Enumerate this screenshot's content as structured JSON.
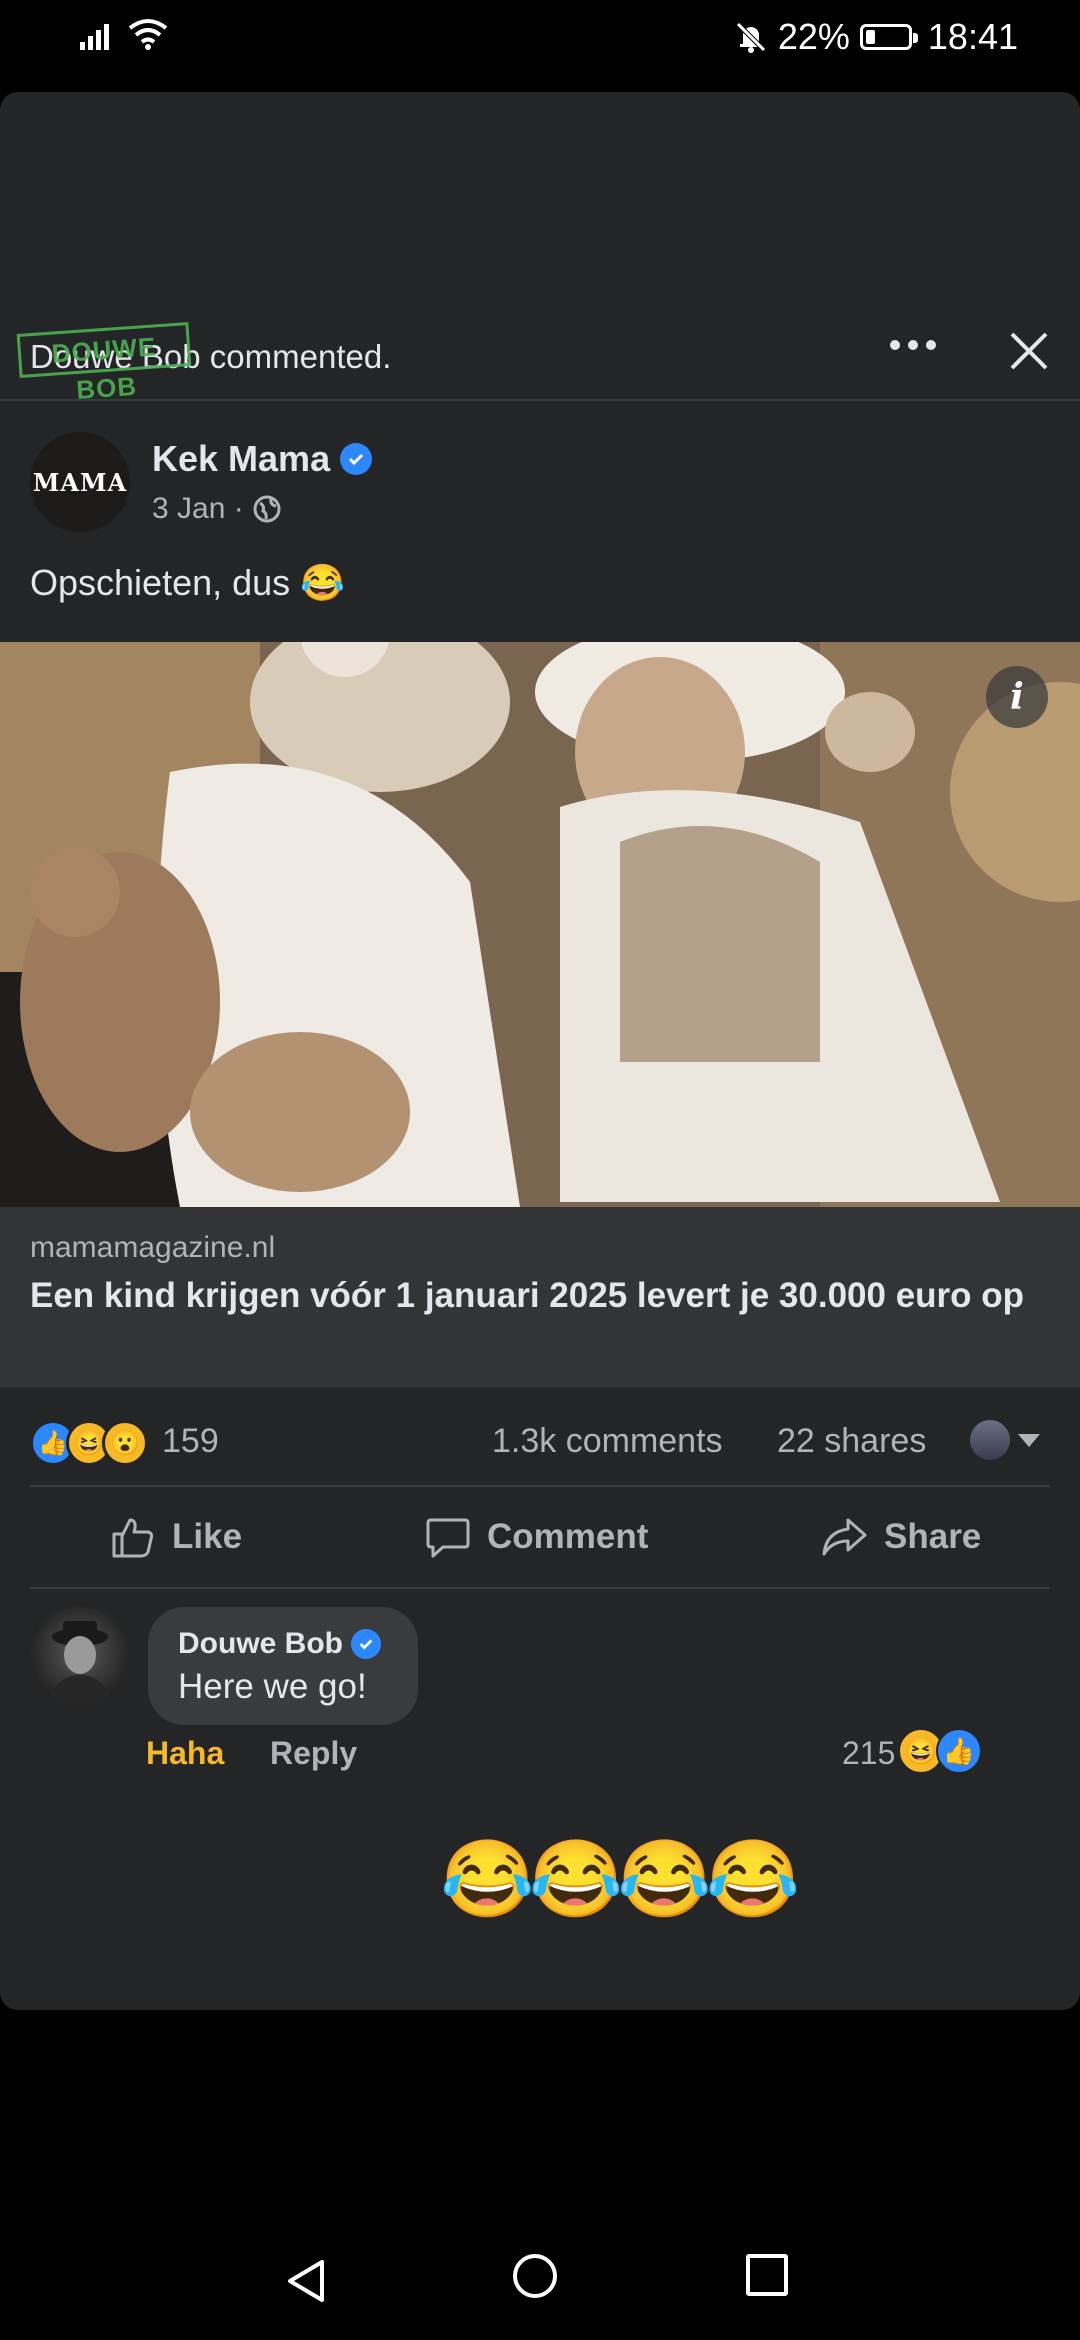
{
  "status_bar": {
    "battery_percent": "22%",
    "battery_level": 0.22,
    "time": "18:41"
  },
  "notification": {
    "text": "Douwe Bob commented.",
    "stamp_label": "DOUWE BOB"
  },
  "post": {
    "avatar_text": "MAMA",
    "page_name": "Kek Mama",
    "date": "3 Jan ·",
    "text": "Opschieten, dus 😂",
    "link_domain": "mamamagazine.nl",
    "link_title": "Een kind krijgen vóór 1 januari 2025 levert je 30.000 euro op"
  },
  "stats": {
    "reactions": [
      "👍",
      "😆",
      "😮"
    ],
    "reaction_count": "159",
    "comments": "1.3k comments",
    "shares": "22 shares"
  },
  "actions": {
    "like": "Like",
    "comment": "Comment",
    "share": "Share"
  },
  "comment": {
    "author": "Douwe Bob",
    "text": "Here we go!",
    "haha_label": "Haha",
    "reply_label": "Reply",
    "reaction_count": "215",
    "reactions": [
      "😆",
      "👍"
    ]
  },
  "reply_emojis": "😂😂😂😂",
  "colors": {
    "card_bg": "#242526",
    "link_bg": "#323436",
    "accent_blue": "#2d88ff",
    "haha_yellow": "#f7b928",
    "muted_text": "#b0b3b8"
  }
}
